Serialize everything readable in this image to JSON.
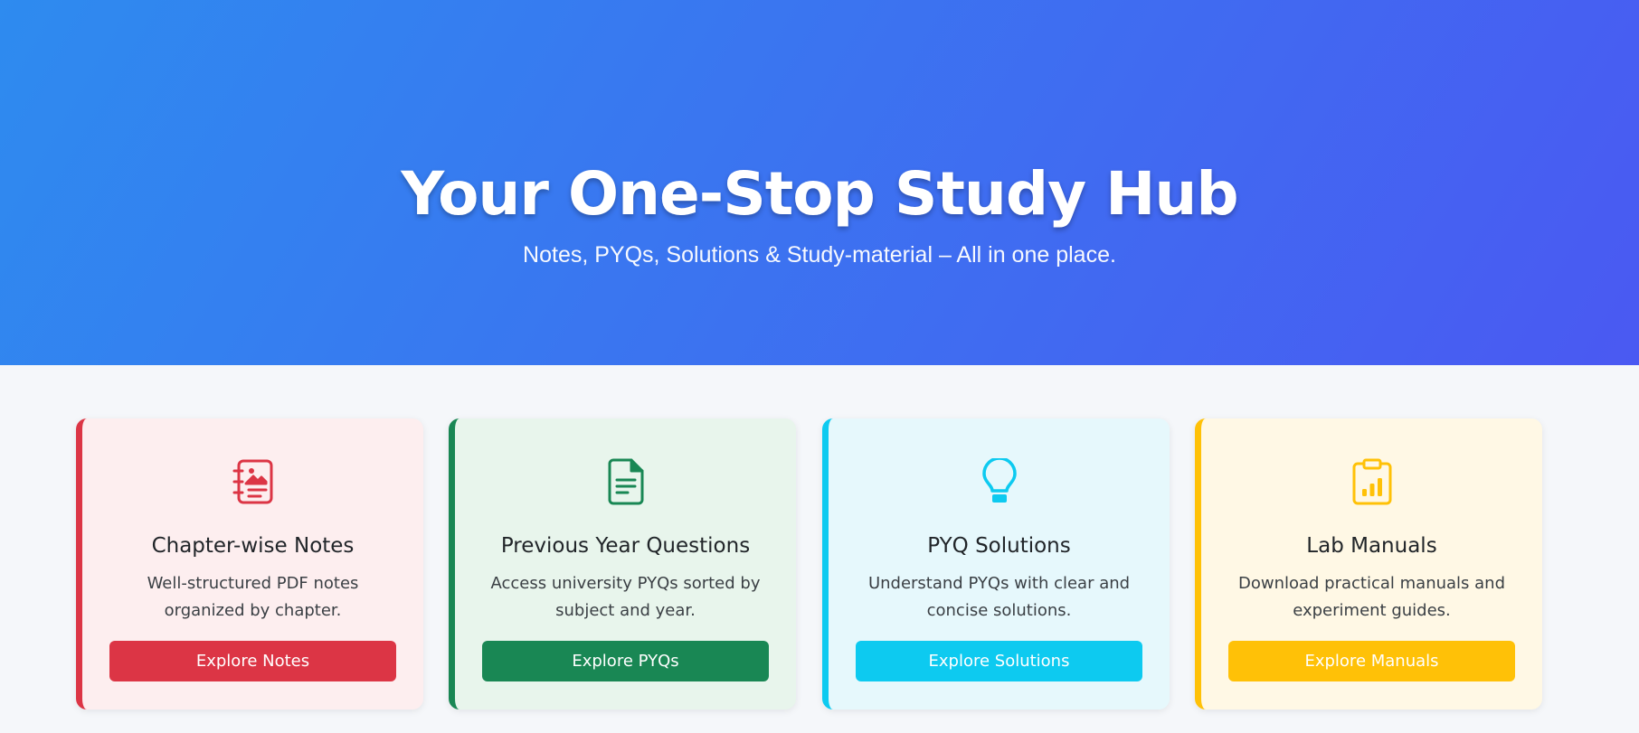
{
  "hero": {
    "title": "Your One-Stop Study Hub",
    "subtitle": "Notes, PYQs, Solutions & Study-material – All in one place.",
    "gradient_start": "#2e8bef",
    "gradient_end": "#4a59f2"
  },
  "cards": [
    {
      "icon": "journal-richtext-icon",
      "title": "Chapter-wise Notes",
      "description": "Well-structured PDF notes organized by chapter.",
      "button_label": "Explore Notes",
      "accent": "#dc3545",
      "background": "#fdeeef"
    },
    {
      "icon": "file-text-icon",
      "title": "Previous Year Questions",
      "description": "Access university PYQs sorted by subject and year.",
      "button_label": "Explore PYQs",
      "accent": "#198754",
      "background": "#e8f5ec"
    },
    {
      "icon": "lightbulb-icon",
      "title": "PYQ Solutions",
      "description": "Understand PYQs with clear and concise solutions.",
      "button_label": "Explore Solutions",
      "accent": "#0dcaf0",
      "background": "#e6f8fc"
    },
    {
      "icon": "clipboard-data-icon",
      "title": "Lab Manuals",
      "description": "Download practical manuals and experiment guides.",
      "button_label": "Explore Manuals",
      "accent": "#ffc107",
      "background": "#fff8e5"
    }
  ]
}
